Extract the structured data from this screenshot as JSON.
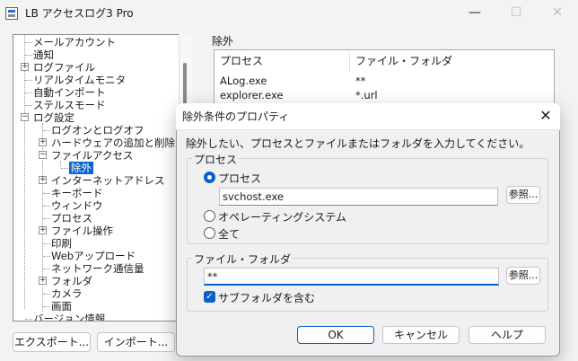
{
  "window": {
    "title": "LB アクセスログ3 Pro",
    "minimize": "—",
    "maximize": "☐",
    "close": "✕"
  },
  "tree": {
    "items": [
      {
        "label": "メールアカウント"
      },
      {
        "label": "通知"
      },
      {
        "label": "ログファイル",
        "expander": "+"
      },
      {
        "label": "リアルタイムモニタ"
      },
      {
        "label": "自動インポート"
      },
      {
        "label": "ステルスモード"
      },
      {
        "label": "ログ設定",
        "expander": "−"
      },
      {
        "label": "ログオンとログオフ"
      },
      {
        "label": "ハードウェアの追加と削除",
        "expander": "+"
      },
      {
        "label": "ファイルアクセス",
        "expander": "−"
      },
      {
        "label": "除外",
        "selected": true
      },
      {
        "label": "インターネットアドレス",
        "expander": "+"
      },
      {
        "label": "キーボード"
      },
      {
        "label": "ウィンドウ"
      },
      {
        "label": "プロセス"
      },
      {
        "label": "ファイル操作",
        "expander": "+"
      },
      {
        "label": "印刷"
      },
      {
        "label": "Webアップロード"
      },
      {
        "label": "ネットワーク通信量"
      },
      {
        "label": "フォルダ",
        "expander": "+"
      },
      {
        "label": "カメラ"
      },
      {
        "label": "画面"
      },
      {
        "label": "バージョン情報"
      }
    ]
  },
  "bottom_buttons": {
    "export": "エクスポート...",
    "import": "インポート..."
  },
  "exclusion": {
    "group_title": "除外",
    "columns": [
      "プロセス",
      "ファイル・フォルダ"
    ],
    "rows": [
      {
        "process": "ALog.exe",
        "path": "**"
      },
      {
        "process": "explorer.exe",
        "path": "*.url"
      }
    ]
  },
  "dialog": {
    "title": "除外条件のプロパティ",
    "close": "✕",
    "instruction": "除外したい、プロセスとファイルまたはフォルダを入力してください。",
    "process_group": "プロセス",
    "radio_process": "プロセス",
    "process_value": "svchost.exe",
    "browse": "参照...",
    "radio_os": "オペレーティングシステム",
    "radio_all": "全て",
    "file_group": "ファイル・フォルダ",
    "file_value": "**",
    "include_subfolders": "サブフォルダを含む",
    "ok": "OK",
    "cancel": "キャンセル",
    "help": "ヘルプ"
  }
}
